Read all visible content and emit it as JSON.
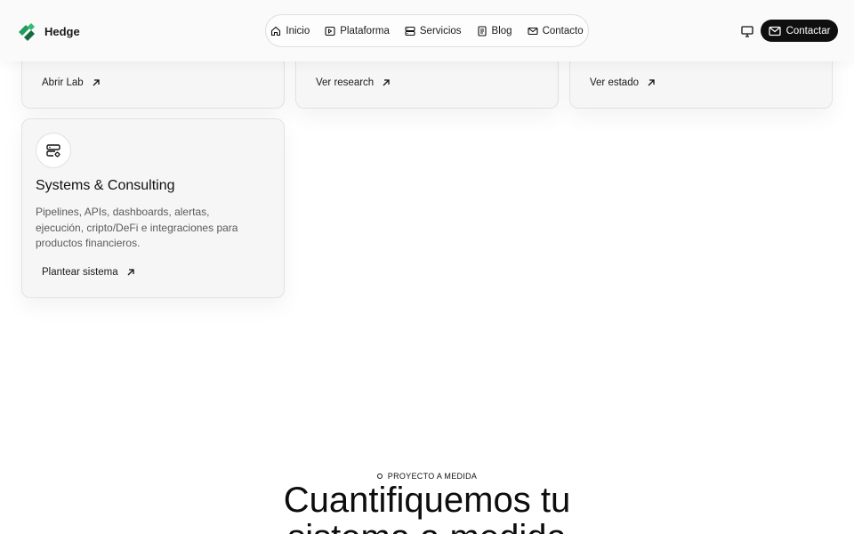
{
  "header": {
    "brand": "Hedge",
    "nav": [
      {
        "label": "Inicio",
        "icon": "home-icon"
      },
      {
        "label": "Plataforma",
        "icon": "play-square-icon"
      },
      {
        "label": "Servicios",
        "icon": "server-icon"
      },
      {
        "label": "Blog",
        "icon": "document-icon"
      },
      {
        "label": "Contacto",
        "icon": "mail-icon"
      }
    ],
    "contact_button": "Contactar",
    "colors": {
      "logo_primary": "#1e9e5a",
      "logo_dark": "#146b3c",
      "button_bg": "#0f0f0f"
    }
  },
  "cards_top": [
    {
      "link": "Abrir Lab"
    },
    {
      "link": "Ver research"
    },
    {
      "link": "Ver estado"
    }
  ],
  "service_card": {
    "icon": "server-settings-icon",
    "title": "Systems & Consulting",
    "description": "Pipelines, APIs, dashboards, alertas, ejecución, cripto/DeFi e integraciones para productos financieros.",
    "link": "Plantear sistema"
  },
  "cta": {
    "eyebrow": "PROYECTO A MEDIDA",
    "headline_line1": "Cuantifiquemos tu",
    "headline_line2": "sistema a medida"
  }
}
